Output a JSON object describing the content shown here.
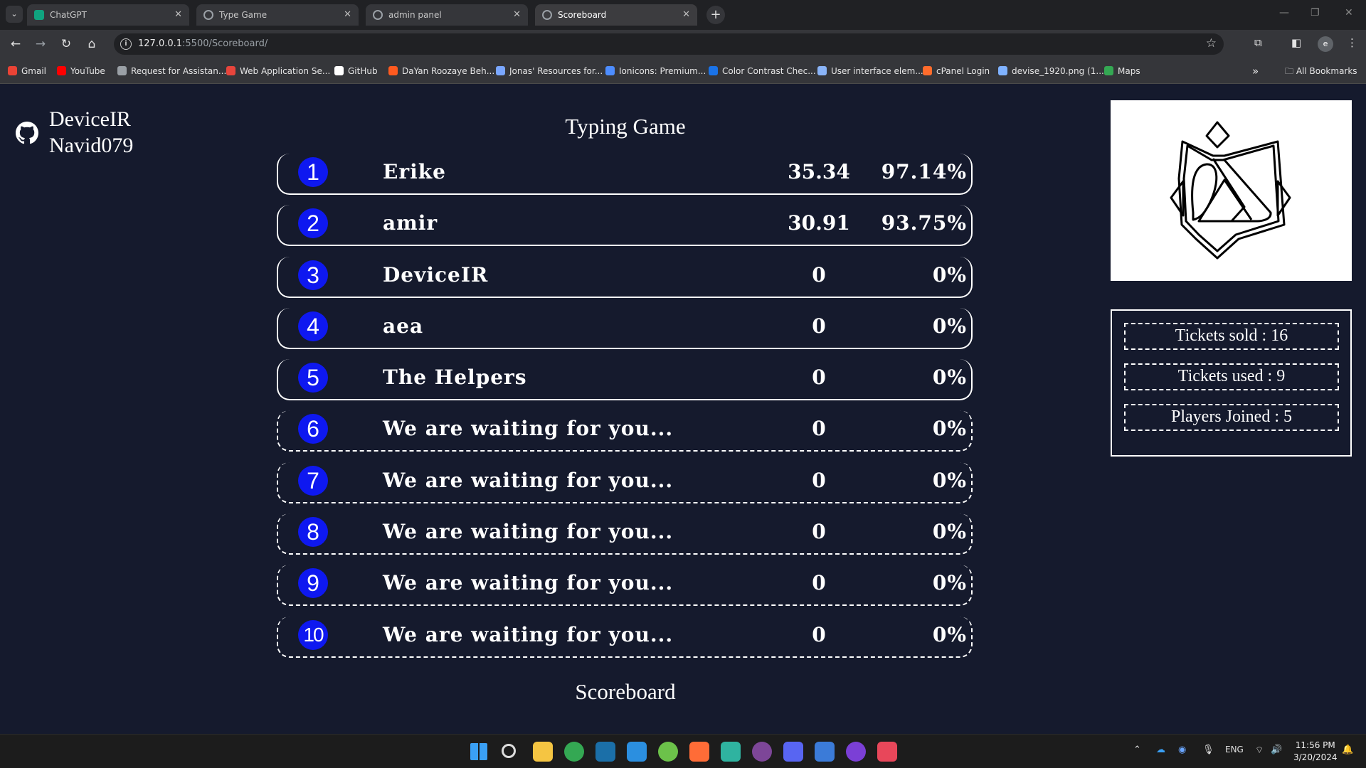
{
  "browser": {
    "tabs": [
      {
        "label": "ChatGPT",
        "icon": "chatgpt-icon"
      },
      {
        "label": "Type Game",
        "icon": "globe-icon"
      },
      {
        "label": "admin panel",
        "icon": "globe-icon"
      },
      {
        "label": "Scoreboard",
        "icon": "globe-icon",
        "active": true
      }
    ],
    "url_host": "127.0.0.1",
    "url_path": ":5500/Scoreboard/",
    "bookmarks": [
      {
        "label": "Gmail",
        "color": "#ea4335"
      },
      {
        "label": "YouTube",
        "color": "#ff0000"
      },
      {
        "label": "Request for Assistan...",
        "color": "#9aa0a6"
      },
      {
        "label": "Web Application Se...",
        "color": "#e8453c"
      },
      {
        "label": "GitHub",
        "color": "#ffffff"
      },
      {
        "label": "DaYan Roozaye Beh...",
        "color": "#ff5a1f"
      },
      {
        "label": "Jonas' Resources for...",
        "color": "#7aa7ff"
      },
      {
        "label": "Ionicons: Premium...",
        "color": "#4d8dff"
      },
      {
        "label": "Color Contrast Chec...",
        "color": "#1a73e8"
      },
      {
        "label": "User interface elem...",
        "color": "#8ab4f8"
      },
      {
        "label": "cPanel Login",
        "color": "#ff6c2c"
      },
      {
        "label": "devise_1920.png (1...",
        "color": "#7fb2ff"
      },
      {
        "label": "Maps",
        "color": "#34a853"
      }
    ],
    "all_bookmarks": "All Bookmarks",
    "profile_initial": "e"
  },
  "sidebar": {
    "names": [
      "DeviceIR",
      "Navid079"
    ]
  },
  "page": {
    "title": "Typing Game",
    "footer": "Scoreboard"
  },
  "scoreboard": [
    {
      "rank": "1",
      "name": "Erike",
      "score": "35.34",
      "accuracy": "97.14%",
      "filled": true
    },
    {
      "rank": "2",
      "name": "amir",
      "score": "30.91",
      "accuracy": "93.75%",
      "filled": true
    },
    {
      "rank": "3",
      "name": "DeviceIR",
      "score": "0",
      "accuracy": "0%",
      "filled": true
    },
    {
      "rank": "4",
      "name": "aea",
      "score": "0",
      "accuracy": "0%",
      "filled": true
    },
    {
      "rank": "5",
      "name": "The Helpers",
      "score": "0",
      "accuracy": "0%",
      "filled": true
    },
    {
      "rank": "6",
      "name": "We are waiting for you...",
      "score": "0",
      "accuracy": "0%",
      "filled": false
    },
    {
      "rank": "7",
      "name": "We are waiting for you...",
      "score": "0",
      "accuracy": "0%",
      "filled": false
    },
    {
      "rank": "8",
      "name": "We are waiting for you...",
      "score": "0",
      "accuracy": "0%",
      "filled": false
    },
    {
      "rank": "9",
      "name": "We are waiting for you...",
      "score": "0",
      "accuracy": "0%",
      "filled": false
    },
    {
      "rank": "10",
      "name": "We are waiting for you...",
      "score": "0",
      "accuracy": "0%",
      "filled": false
    }
  ],
  "stats": {
    "tickets_sold": "Tickets sold : 16",
    "tickets_used": "Tickets used : 9",
    "players_joined": "Players Joined : 5"
  },
  "taskbar": {
    "apps": [
      {
        "icon": "windows-start-icon",
        "color": "#3aa0f5"
      },
      {
        "icon": "search-icon",
        "color": "#dddddd"
      },
      {
        "icon": "file-explorer-icon",
        "color": "#f5c542"
      },
      {
        "icon": "chrome-icon",
        "color": "#34a853"
      },
      {
        "icon": "steam-icon",
        "color": "#1b6fa8"
      },
      {
        "icon": "vscode-icon",
        "color": "#2b8fe0"
      },
      {
        "icon": "mongodb-icon",
        "color": "#6cc24a"
      },
      {
        "icon": "postman-icon",
        "color": "#ff6c37"
      },
      {
        "icon": "edge-icon",
        "color": "#2fb3a0"
      },
      {
        "icon": "tor-icon",
        "color": "#7d4698"
      },
      {
        "icon": "discord-icon",
        "color": "#5865f2"
      },
      {
        "icon": "check-app-icon",
        "color": "#3b7bd8"
      },
      {
        "icon": "thunder-client-icon",
        "color": "#7b3fd6"
      },
      {
        "icon": "snipping-tool-icon",
        "color": "#e8475a"
      }
    ],
    "language": "ENG",
    "time": "11:56 PM",
    "date": "3/20/2024"
  }
}
